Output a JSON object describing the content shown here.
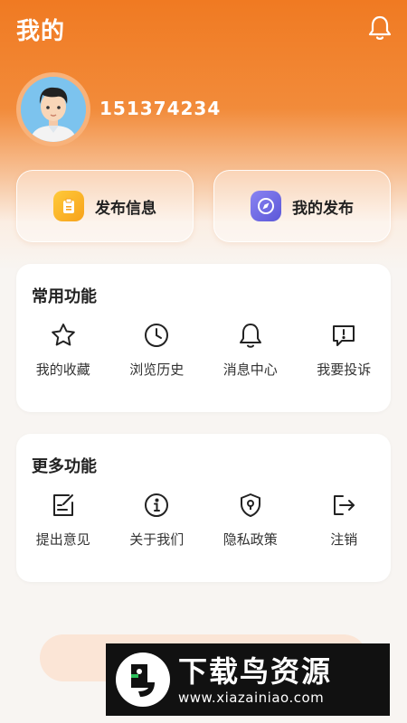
{
  "header": {
    "title": "我的"
  },
  "profile": {
    "user_id": "151374234"
  },
  "quick_actions": [
    {
      "label": "发布信息",
      "icon": "clipboard-icon"
    },
    {
      "label": "我的发布",
      "icon": "compass-icon"
    }
  ],
  "common": {
    "title": "常用功能",
    "items": [
      {
        "label": "我的收藏",
        "icon": "star-icon"
      },
      {
        "label": "浏览历史",
        "icon": "clock-icon"
      },
      {
        "label": "消息中心",
        "icon": "bell-icon"
      },
      {
        "label": "我要投诉",
        "icon": "complaint-icon"
      }
    ]
  },
  "more": {
    "title": "更多功能",
    "items": [
      {
        "label": "提出意见",
        "icon": "edit-icon"
      },
      {
        "label": "关于我们",
        "icon": "info-icon"
      },
      {
        "label": "隐私政策",
        "icon": "shield-icon"
      },
      {
        "label": "注销",
        "icon": "logout-icon"
      }
    ]
  },
  "watermark": {
    "name": "下载鸟资源",
    "url": "www.xiazainiao.com"
  },
  "colors": {
    "accent": "#f07a22",
    "background": "#f8f5f2"
  }
}
